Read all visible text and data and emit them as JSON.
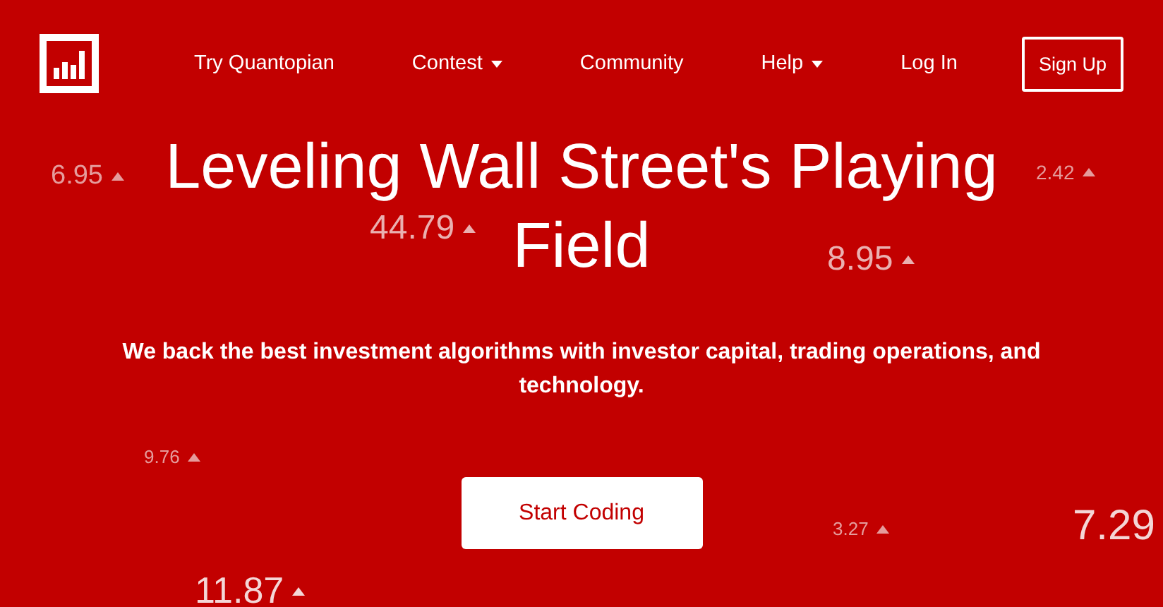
{
  "nav": {
    "links": [
      {
        "label": "Try Quantopian",
        "dropdown": false
      },
      {
        "label": "Contest",
        "dropdown": true
      },
      {
        "label": "Community",
        "dropdown": false
      },
      {
        "label": "Help",
        "dropdown": true
      },
      {
        "label": "Log In",
        "dropdown": false
      }
    ],
    "signup": "Sign Up"
  },
  "hero": {
    "title_lines": [
      "Leveling Wall Street's Playing",
      "Field"
    ],
    "subtitle": "We back the best investment algorithms with investor capital, trading operations, and technology.",
    "button": "Start Coding"
  },
  "tickers": [
    {
      "value": "6.95",
      "kind": "blurred"
    },
    {
      "value": "44.79",
      "kind": "soft"
    },
    {
      "value": "8.95",
      "kind": "soft"
    },
    {
      "value": "2.42",
      "kind": "blurred"
    },
    {
      "value": "9.76",
      "kind": "blurred"
    },
    {
      "value": "3.27",
      "kind": "blurred"
    },
    {
      "value": "7.29",
      "kind": "sharp"
    },
    {
      "value": "11.87",
      "kind": "sharp"
    }
  ]
}
